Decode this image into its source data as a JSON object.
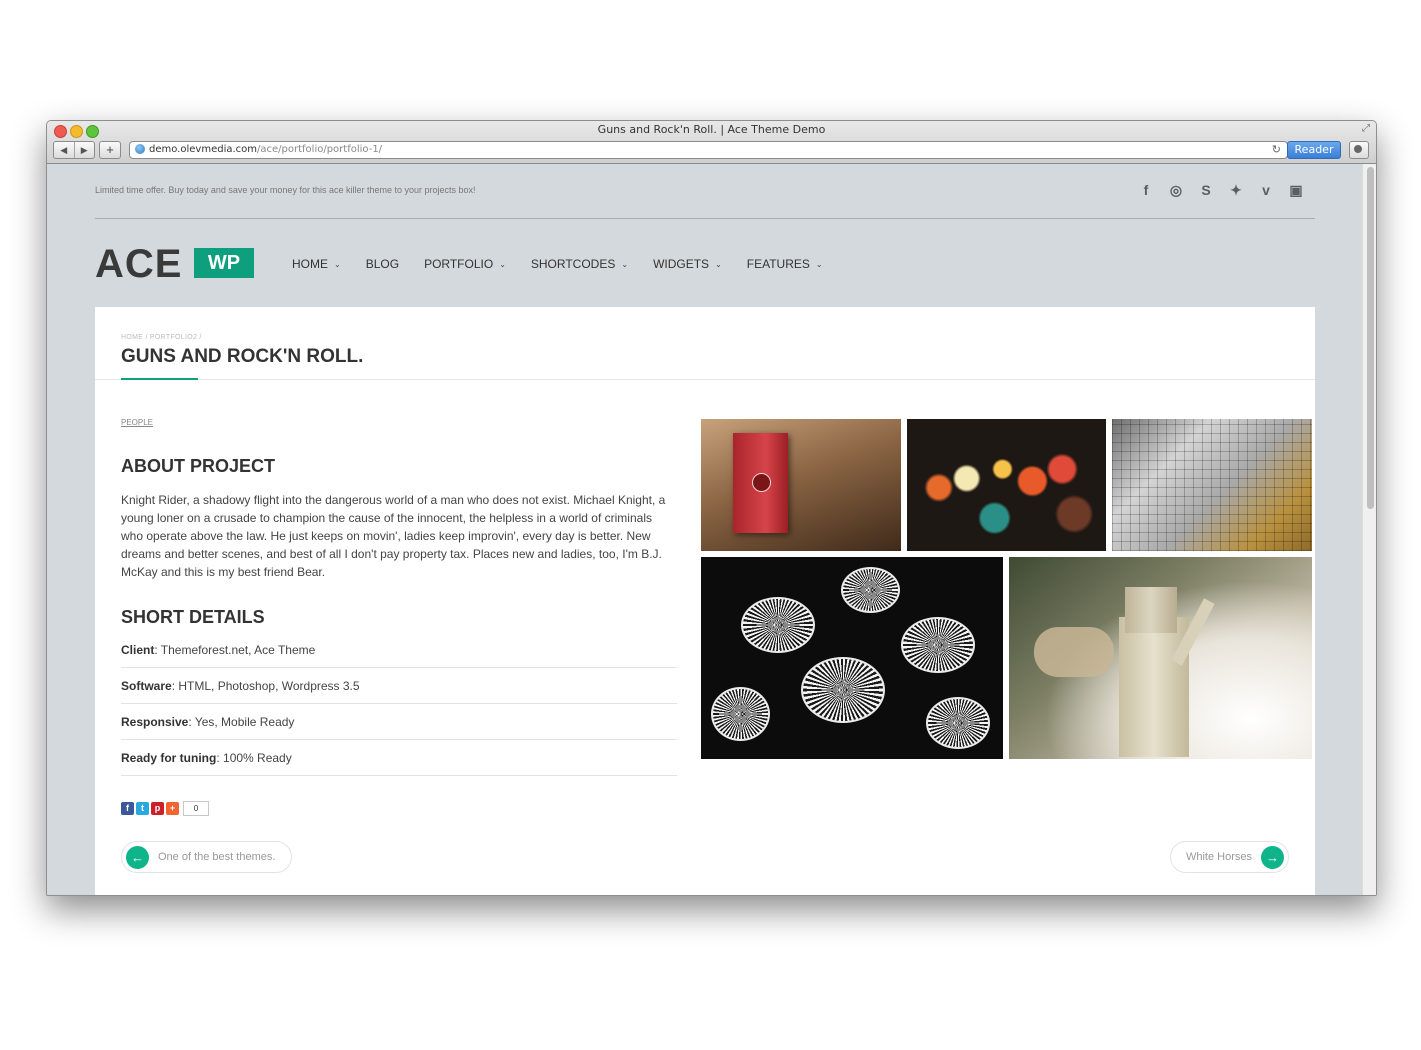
{
  "browser": {
    "window_title": "Guns and Rock'n Roll. | Ace Theme Demo",
    "url_host": "demo.olevmedia.com",
    "url_path": "/ace/portfolio/portfolio-1/",
    "reader_label": "Reader",
    "back_glyph": "◀",
    "forward_glyph": "▶",
    "add_tab_glyph": "+",
    "reload_glyph": "↻",
    "fullscreen_glyph": "⤢"
  },
  "topbar": {
    "promo_text": "Limited time offer. Buy today and save your money for this ace killer theme to your projects box!",
    "social_icons": [
      {
        "name": "facebook-icon",
        "glyph": "f"
      },
      {
        "name": "dribbble-icon",
        "glyph": "◎"
      },
      {
        "name": "skype-icon",
        "glyph": "S"
      },
      {
        "name": "twitter-icon",
        "glyph": "✦"
      },
      {
        "name": "vimeo-icon",
        "glyph": "v"
      },
      {
        "name": "youtube-icon",
        "glyph": "▣"
      }
    ]
  },
  "logo": {
    "main": "ACE",
    "badge": "WP"
  },
  "nav": [
    {
      "label": "HOME",
      "has_dropdown": true
    },
    {
      "label": "BLOG",
      "has_dropdown": false
    },
    {
      "label": "PORTFOLIO",
      "has_dropdown": true
    },
    {
      "label": "SHORTCODES",
      "has_dropdown": true
    },
    {
      "label": "WIDGETS",
      "has_dropdown": true
    },
    {
      "label": "FEATURES",
      "has_dropdown": true
    }
  ],
  "page": {
    "breadcrumb": "HOME / PORTFOLIO2 /",
    "title": "GUNS AND ROCK'N ROLL.",
    "category_tag": "PEOPLE",
    "about_heading": "ABOUT PROJECT",
    "about_text": "Knight Rider, a shadowy flight into the dangerous world of a man who does not exist. Michael Knight, a young loner on a crusade to champion the cause of the innocent, the helpless in a world of criminals who operate above the law. He just keeps on movin', ladies keep improvin', every day is better. New dreams and better scenes, and best of all I don't pay property tax. Places new and ladies, too, I'm B.J. McKay and this is my best friend Bear.",
    "details_heading": "SHORT DETAILS",
    "details": [
      {
        "label": "Client",
        "value": "Themeforest.net, Ace Theme"
      },
      {
        "label": "Software",
        "value": "HTML, Photoshop, Wordpress 3.5"
      },
      {
        "label": "Responsive",
        "value": "Yes, Mobile Ready"
      },
      {
        "label": "Ready for tuning",
        "value": "100% Ready"
      }
    ],
    "share": {
      "count": "0"
    },
    "prev_label": "One of the best themes.",
    "next_label": "White Horses",
    "prev_arrow": "←",
    "next_arrow": "→"
  },
  "colors": {
    "accent": "#0e9f7e",
    "page_bg": "#d4d9de",
    "content_bg": "#ffffff",
    "text": "#333333"
  }
}
